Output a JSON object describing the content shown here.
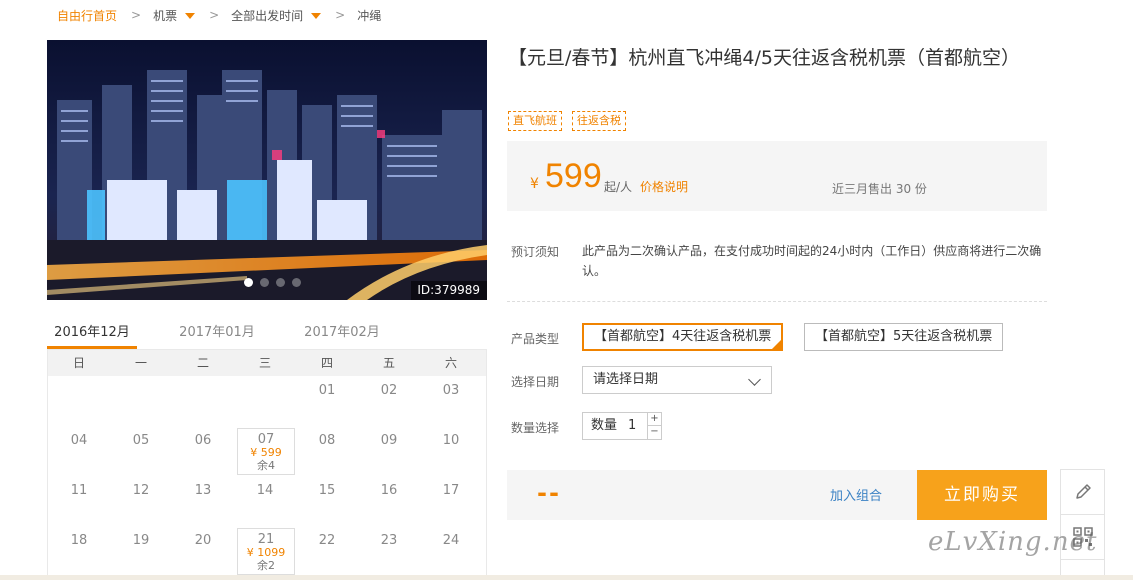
{
  "breadcrumb": {
    "home": "自由行首页",
    "category": "机票",
    "departure": "全部出发时间",
    "destination": "冲绳",
    "separator": ">"
  },
  "gallery": {
    "image_id": "ID:379989",
    "slide_count": 4,
    "active_slide": 1
  },
  "calendar": {
    "months": [
      "2016年12月",
      "2017年01月",
      "2017年02月"
    ],
    "active_month": 0,
    "weekdays": [
      "日",
      "一",
      "二",
      "三",
      "四",
      "五",
      "六"
    ],
    "rows": [
      [
        {
          "day": ""
        },
        {
          "day": ""
        },
        {
          "day": ""
        },
        {
          "day": ""
        },
        {
          "day": "01"
        },
        {
          "day": "02"
        },
        {
          "day": "03"
        }
      ],
      [
        {
          "day": "04"
        },
        {
          "day": "05"
        },
        {
          "day": "06"
        },
        {
          "day": "07",
          "price": "¥ 599",
          "left": "余4"
        },
        {
          "day": "08"
        },
        {
          "day": "09"
        },
        {
          "day": "10"
        }
      ],
      [
        {
          "day": "11"
        },
        {
          "day": "12"
        },
        {
          "day": "13"
        },
        {
          "day": "14"
        },
        {
          "day": "15"
        },
        {
          "day": "16"
        },
        {
          "day": "17"
        }
      ],
      [
        {
          "day": "18"
        },
        {
          "day": "19"
        },
        {
          "day": "20"
        },
        {
          "day": "21",
          "price": "¥ 1099",
          "left": "余2"
        },
        {
          "day": "22"
        },
        {
          "day": "23"
        },
        {
          "day": "24"
        }
      ]
    ]
  },
  "product": {
    "title": "【元旦/春节】杭州直飞冲绳4/5天往返含税机票（首都航空）",
    "tags": [
      "直飞航班",
      "往返含税"
    ],
    "price_currency": "¥",
    "price": "599",
    "price_unit": "起/人",
    "price_link": "价格说明",
    "sold": "近三月售出 30 份",
    "notice_label": "预订须知",
    "notice_text": "此产品为二次确认产品，在支付成功时间起的24小时内（工作日）供应商将进行二次确认。"
  },
  "options": {
    "type_label": "产品类型",
    "types": [
      "【首都航空】4天往返含税机票",
      "【首都航空】5天往返含税机票"
    ],
    "active_type": 0,
    "date_label": "选择日期",
    "date_placeholder": "请选择日期",
    "qty_label": "数量选择",
    "qty_prefix": "数量",
    "qty_value": "1",
    "qty_plus": "+",
    "qty_minus": "−"
  },
  "actions": {
    "total": "--",
    "combo": "加入组合",
    "buy": "立即购买"
  },
  "watermark": "eLvXing.net",
  "colors": {
    "accent": "#f08300",
    "buy_button": "#f7a21b",
    "link": "#3b82c4"
  }
}
